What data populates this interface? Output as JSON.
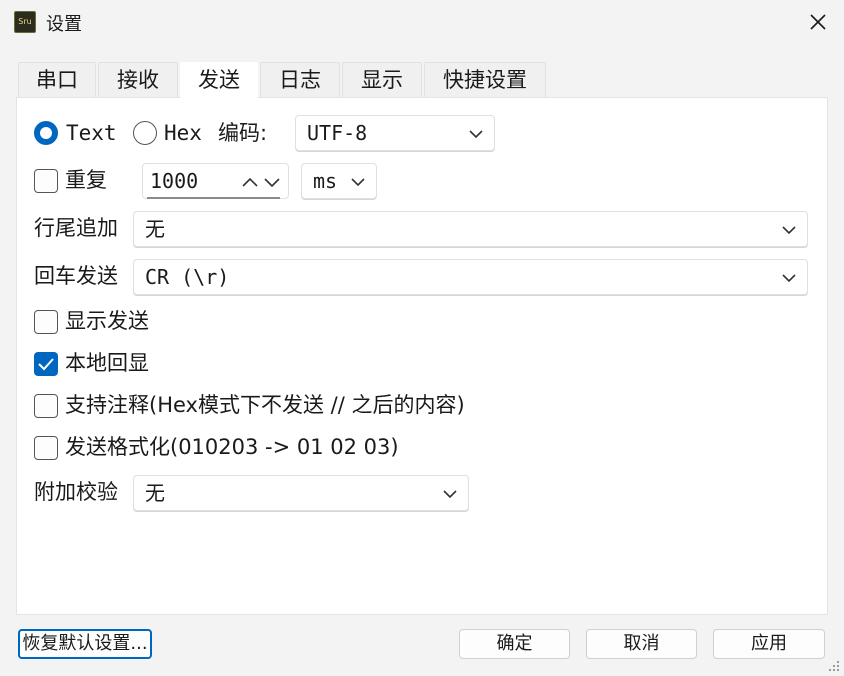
{
  "window": {
    "title": "设置",
    "icon_text": "Sru"
  },
  "tabs": [
    {
      "label": "串口",
      "active": false
    },
    {
      "label": "接收",
      "active": false
    },
    {
      "label": "发送",
      "active": true
    },
    {
      "label": "日志",
      "active": false
    },
    {
      "label": "显示",
      "active": false
    },
    {
      "label": "快捷设置",
      "active": false
    }
  ],
  "send": {
    "mode_text": "Text",
    "mode_hex": "Hex",
    "selected_mode": "Text",
    "encoding_label": "编码:",
    "encoding_value": "UTF-8",
    "repeat_label": "重复",
    "repeat_checked": false,
    "repeat_interval": "1000",
    "repeat_unit": "ms",
    "line_end_label": "行尾追加",
    "line_end_value": "无",
    "enter_label": "回车发送",
    "enter_value": "CR (\\r)",
    "show_send_label": "显示发送",
    "show_send_checked": false,
    "local_echo_label": "本地回显",
    "local_echo_checked": true,
    "comment_label": "支持注释(Hex模式下不发送 // 之后的内容)",
    "comment_checked": false,
    "format_label": "发送格式化(010203 -> 01 02 03)",
    "format_checked": false,
    "checksum_label": "附加校验",
    "checksum_value": "无"
  },
  "buttons": {
    "restore_defaults": "恢复默认设置...",
    "ok": "确定",
    "cancel": "取消",
    "apply": "应用"
  },
  "colors": {
    "accent": "#0067c0",
    "panel": "#ffffff",
    "background": "#f3f3f3"
  }
}
